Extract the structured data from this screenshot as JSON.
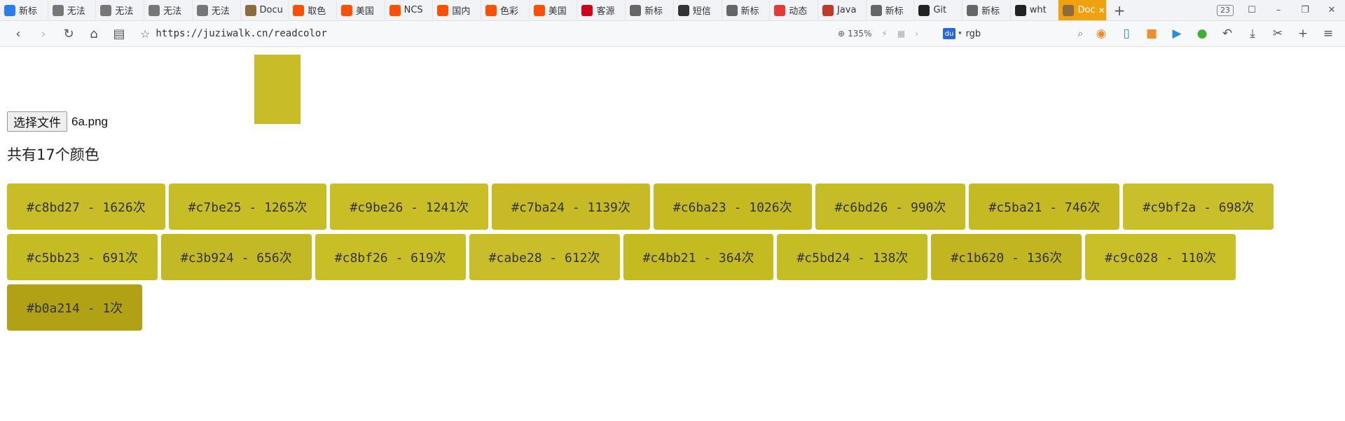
{
  "tabs": [
    {
      "label": "新标",
      "icon": "grid-icon",
      "color": "#2b7de9"
    },
    {
      "label": "无法",
      "icon": "globe-icon",
      "color": "#777777"
    },
    {
      "label": "无法",
      "icon": "globe-icon",
      "color": "#777777"
    },
    {
      "label": "无法",
      "icon": "globe-icon",
      "color": "#777777"
    },
    {
      "label": "无法",
      "icon": "globe-icon",
      "color": "#777777"
    },
    {
      "label": "Docu",
      "icon": "doc-image-icon",
      "color": "#8a6d3b"
    },
    {
      "label": "取色",
      "icon": "taobao-icon",
      "color": "#ff5000"
    },
    {
      "label": "美国",
      "icon": "taobao-icon",
      "color": "#ff5000"
    },
    {
      "label": "NCS",
      "icon": "taobao-icon",
      "color": "#ff5000"
    },
    {
      "label": "国内",
      "icon": "taobao-icon",
      "color": "#ff5000"
    },
    {
      "label": "色彩",
      "icon": "taobao-icon",
      "color": "#ff5000"
    },
    {
      "label": "美国",
      "icon": "taobao-icon",
      "color": "#ff5000"
    },
    {
      "label": "客源",
      "icon": "t-logo-icon",
      "color": "#d0021b"
    },
    {
      "label": "新标",
      "icon": "grid-icon",
      "color": "#666666"
    },
    {
      "label": "短信",
      "icon": "link-icon",
      "color": "#333333"
    },
    {
      "label": "新标",
      "icon": "grid-icon",
      "color": "#666666"
    },
    {
      "label": "动态",
      "icon": "g-logo-icon",
      "color": "#e53935"
    },
    {
      "label": "Java",
      "icon": "jb-logo-icon",
      "color": "#c0392b"
    },
    {
      "label": "新标",
      "icon": "grid-icon",
      "color": "#666666"
    },
    {
      "label": "Git",
      "icon": "github-icon",
      "color": "#222222"
    },
    {
      "label": "新标",
      "icon": "grid-icon",
      "color": "#666666"
    },
    {
      "label": "wht",
      "icon": "github-icon",
      "color": "#222222"
    },
    {
      "label": "Doc",
      "icon": "doc-image-icon",
      "color": "#8a6d3b",
      "active": true
    }
  ],
  "tab_count": "23",
  "address": {
    "url": "https://juziwalk.cn/readcolor",
    "zoom": "135%",
    "search_text": "rgb",
    "search_engine_label": "du"
  },
  "page": {
    "file_button": "选择文件",
    "file_name": "6a.png",
    "preview_color": "#c8bd27",
    "count_text": "共有17个颜色",
    "colors": [
      {
        "label": "#c8bd27 - 1626次",
        "hex": "#c8bd27"
      },
      {
        "label": "#c7be25 - 1265次",
        "hex": "#c7be25"
      },
      {
        "label": "#c9be26 - 1241次",
        "hex": "#c9be26"
      },
      {
        "label": "#c7ba24 - 1139次",
        "hex": "#c7ba24"
      },
      {
        "label": "#c6ba23 - 1026次",
        "hex": "#c6ba23"
      },
      {
        "label": "#c6bd26 - 990次",
        "hex": "#c6bd26"
      },
      {
        "label": "#c5ba21 - 746次",
        "hex": "#c5ba21"
      },
      {
        "label": "#c9bf2a - 698次",
        "hex": "#c9bf2a"
      },
      {
        "label": "#c5bb23 - 691次",
        "hex": "#c5bb23"
      },
      {
        "label": "#c3b924 - 656次",
        "hex": "#c3b924"
      },
      {
        "label": "#c8bf26 - 619次",
        "hex": "#c8bf26"
      },
      {
        "label": "#cabe28 - 612次",
        "hex": "#cabe28"
      },
      {
        "label": "#c4bb21 - 364次",
        "hex": "#c4bb21"
      },
      {
        "label": "#c5bd24 - 138次",
        "hex": "#c5bd24"
      },
      {
        "label": "#c1b620 - 136次",
        "hex": "#c1b620"
      },
      {
        "label": "#c9c028 - 110次",
        "hex": "#c9c028"
      },
      {
        "label": "#b0a214 - 1次",
        "hex": "#b0a214"
      }
    ]
  }
}
